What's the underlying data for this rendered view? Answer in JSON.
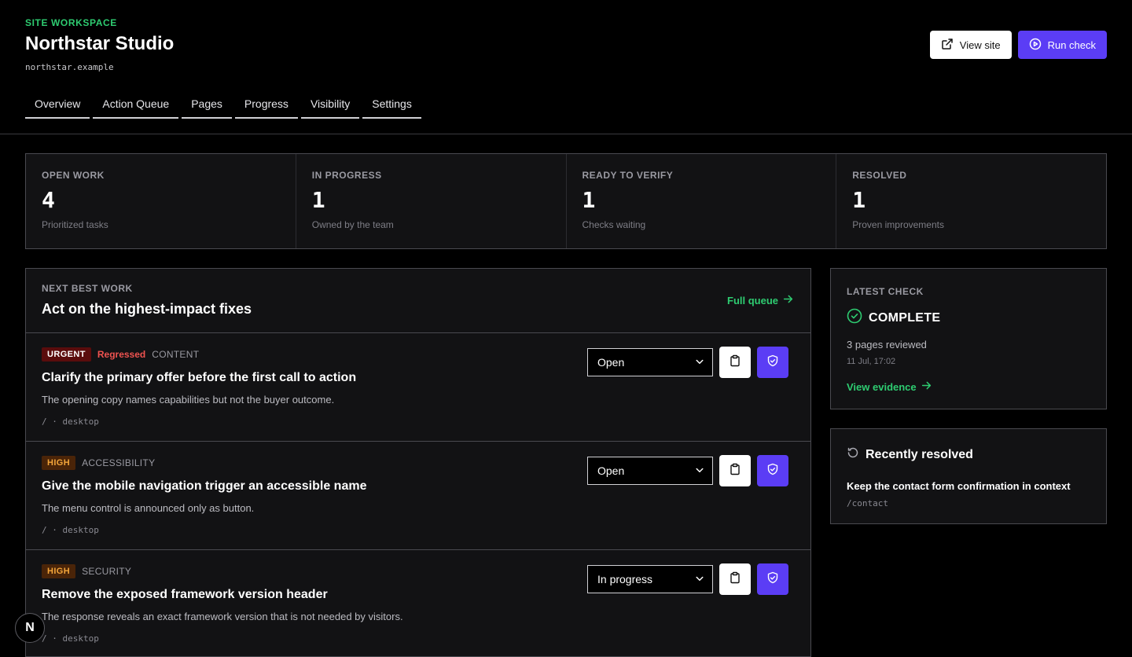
{
  "header": {
    "eyebrow": "SITE WORKSPACE",
    "title": "Northstar Studio",
    "domain": "northstar.example",
    "view_site_label": "View site",
    "run_check_label": "Run check"
  },
  "tabs": [
    {
      "label": "Overview"
    },
    {
      "label": "Action Queue"
    },
    {
      "label": "Pages"
    },
    {
      "label": "Progress"
    },
    {
      "label": "Visibility"
    },
    {
      "label": "Settings"
    }
  ],
  "stats": [
    {
      "label": "OPEN WORK",
      "value": "4",
      "sub": "Prioritized tasks"
    },
    {
      "label": "IN PROGRESS",
      "value": "1",
      "sub": "Owned by the team"
    },
    {
      "label": "READY TO VERIFY",
      "value": "1",
      "sub": "Checks waiting"
    },
    {
      "label": "RESOLVED",
      "value": "1",
      "sub": "Proven improvements"
    }
  ],
  "work": {
    "eyebrow": "NEXT BEST WORK",
    "title": "Act on the highest-impact fixes",
    "full_queue_label": "Full queue",
    "tasks": [
      {
        "priority": "URGENT",
        "flag": "Regressed",
        "category": "CONTENT",
        "title": "Clarify the primary offer before the first call to action",
        "desc": "The opening copy names capabilities but not the buyer outcome.",
        "meta": "/ · desktop",
        "status": "Open"
      },
      {
        "priority": "HIGH",
        "flag": "",
        "category": "ACCESSIBILITY",
        "title": "Give the mobile navigation trigger an accessible name",
        "desc": "The menu control is announced only as button.",
        "meta": "/ · desktop",
        "status": "Open"
      },
      {
        "priority": "HIGH",
        "flag": "",
        "category": "SECURITY",
        "title": "Remove the exposed framework version header",
        "desc": "The response reveals an exact framework version that is not needed by visitors.",
        "meta": "/ · desktop",
        "status": "In progress"
      }
    ]
  },
  "latest_check": {
    "eyebrow": "LATEST CHECK",
    "status": "COMPLETE",
    "pages": "3 pages reviewed",
    "date": "11 Jul, 17:02",
    "evidence_label": "View evidence"
  },
  "recently_resolved": {
    "title": "Recently resolved",
    "item": "Keep the contact form confirmation in context",
    "path": "/contact"
  },
  "fab": {
    "label": "N"
  },
  "colors": {
    "accent_green": "#2ecc71",
    "primary_violet": "#5b3df5",
    "urgent_bg": "#5a0c0c",
    "high_fg": "#f3a53a",
    "regressed": "#ef5350"
  }
}
